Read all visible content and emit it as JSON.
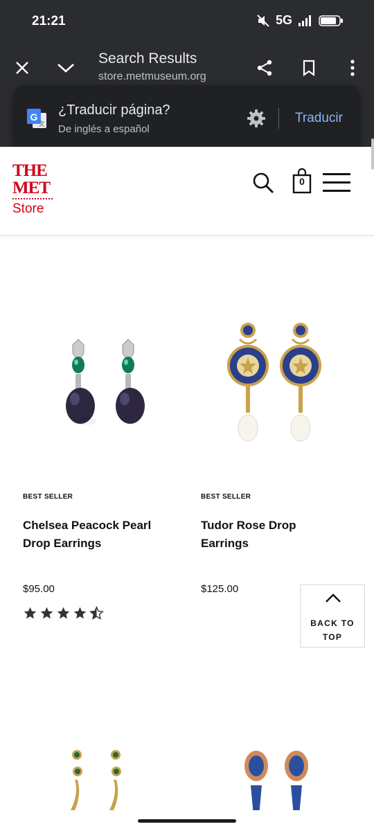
{
  "status_bar": {
    "time": "21:21",
    "network": "5G",
    "battery_percent": 85
  },
  "browser": {
    "title": "Search Results",
    "url": "store.metmuseum.org"
  },
  "translate_popup": {
    "title": "¿Traducir página?",
    "subtitle": "De inglés a español",
    "translate_label": "Traducir"
  },
  "site_header": {
    "logo_line1": "THE",
    "logo_line2": "MET",
    "logo_store": "Store",
    "cart_count": "0",
    "logo_color": "#d0021b"
  },
  "products": [
    {
      "badge": "BEST SELLER",
      "name": "Chelsea Peacock Pearl Drop Earrings",
      "price": "$95.00",
      "rating": 4.5
    },
    {
      "badge": "BEST SELLER",
      "name": "Tudor Rose Drop Earrings",
      "price": "$125.00"
    }
  ],
  "back_to_top": {
    "line1": "BACK TO",
    "line2": "TOP"
  },
  "colors": {
    "browser_chrome": "#2b2c30",
    "popup_bg": "#202124",
    "accent_link": "#8ab4f8",
    "brand_red": "#d0021b"
  }
}
